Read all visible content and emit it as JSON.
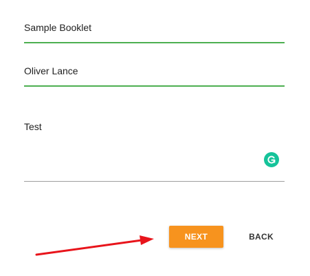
{
  "form": {
    "title_value": "Sample Booklet",
    "author_value": "Oliver Lance",
    "description_value": "Test"
  },
  "actions": {
    "next_label": "NEXT",
    "back_label": "BACK"
  },
  "colors": {
    "active_underline": "#4caf50",
    "idle_underline": "#9e9e9e",
    "next_button": "#f7931e",
    "grammarly_badge": "#15c39a",
    "annotation_arrow": "#e8141b"
  },
  "icons": {
    "grammarly": "grammarly-icon",
    "annotation": "red-arrow-icon"
  }
}
